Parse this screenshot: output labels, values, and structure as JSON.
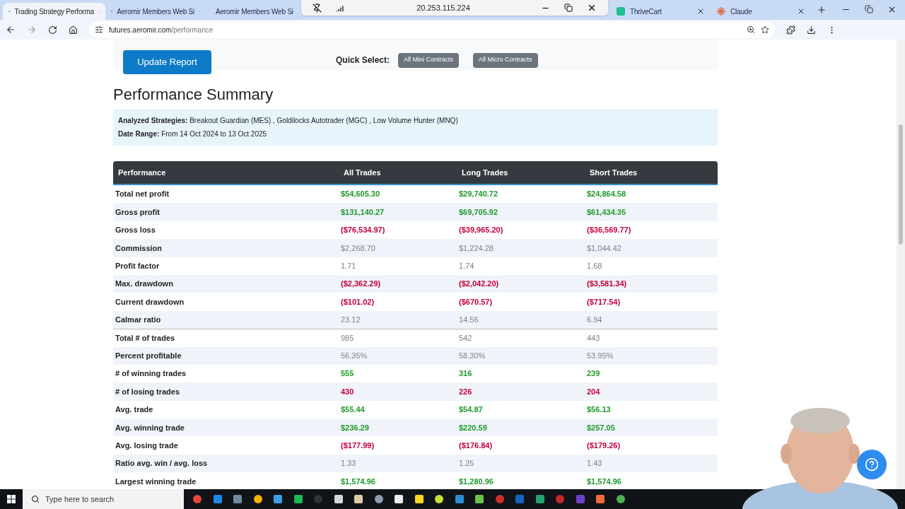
{
  "tabs": [
    {
      "title": "Trading Strategy Performa",
      "selected": true,
      "kind": "site"
    },
    {
      "title": "Aeromir Members Web Si",
      "selected": false,
      "kind": "site"
    },
    {
      "title": "Aeromir Members Web Si",
      "selected": false,
      "kind": "site"
    },
    {
      "title": "ThriveCart",
      "selected": false,
      "kind": "cart"
    },
    {
      "title": "Claude",
      "selected": false,
      "kind": "spark"
    }
  ],
  "remote_toolbar": {
    "address": "20.253.115.224"
  },
  "address_bar": {
    "host": "futures.aeromir.com",
    "path": "/performance"
  },
  "form": {
    "update_button": "Update Report",
    "quick_select_label": "Quick Select:",
    "quick_buttons": [
      "All Mini Contracts",
      "All Micro Contracts"
    ]
  },
  "title": "Performance Summary",
  "info": [
    {
      "label": "Analyzed Strategies:",
      "value": "Breakout Guardian (MES) , Goldilocks Autotrader (MGC) , Low Volume Hunter (MNQ)"
    },
    {
      "label": "Date Range:",
      "value": "From 14 Oct 2024 to 13 Oct 2025"
    }
  ],
  "table": {
    "columns": [
      "Performance",
      "All Trades",
      "Long Trades",
      "Short Trades"
    ],
    "rows": [
      {
        "kind": "positive",
        "cells": [
          "Total net profit",
          "$54,605.30",
          "$29,740.72",
          "$24,864.58"
        ]
      },
      {
        "kind": "positive",
        "cells": [
          "Gross profit",
          "$131,140.27",
          "$69,705.92",
          "$61,434.35"
        ]
      },
      {
        "kind": "negative",
        "cells": [
          "Gross loss",
          "($76,534.97)",
          "($39,965.20)",
          "($36,569.77)"
        ]
      },
      {
        "kind": "neutral",
        "cells": [
          "Commission",
          "$2,268.70",
          "$1,224.28",
          "$1,044.42"
        ]
      },
      {
        "kind": "neutral",
        "cells": [
          "Profit factor",
          "1.71",
          "1.74",
          "1.68"
        ]
      },
      {
        "kind": "negative",
        "cells": [
          "Max. drawdown",
          "($2,362.29)",
          "($2,042.20)",
          "($3,581.34)"
        ]
      },
      {
        "kind": "negative",
        "cells": [
          "Current drawdown",
          "($101.02)",
          "($670.57)",
          "($717.54)"
        ]
      },
      {
        "kind": "neutral",
        "cells": [
          "Calmar ratio",
          "23.12",
          "14.56",
          "6.94"
        ]
      },
      {
        "kind": "neutral",
        "cells": [
          "Total # of trades",
          "985",
          "542",
          "443"
        ]
      },
      {
        "kind": "neutral",
        "cells": [
          "Percent profitable",
          "56.35%",
          "58.30%",
          "53.95%"
        ]
      },
      {
        "kind": "positive",
        "cells": [
          "# of winning trades",
          "555",
          "316",
          "239"
        ]
      },
      {
        "kind": "negative",
        "cells": [
          "# of losing trades",
          "430",
          "226",
          "204"
        ]
      },
      {
        "kind": "positive",
        "cells": [
          "Avg. trade",
          "$55.44",
          "$54.87",
          "$56.13"
        ]
      },
      {
        "kind": "positive",
        "cells": [
          "Avg. winning trade",
          "$236.29",
          "$220.59",
          "$257.05"
        ]
      },
      {
        "kind": "negative",
        "cells": [
          "Avg. losing trade",
          "($177.99)",
          "($176.84)",
          "($179.26)"
        ]
      },
      {
        "kind": "neutral",
        "cells": [
          "Ratio avg. win / avg. loss",
          "1.33",
          "1.25",
          "1.43"
        ]
      },
      {
        "kind": "positive",
        "cells": [
          "Largest winning trade",
          "$1,574.96",
          "$1,280.96",
          "$1,574.96"
        ]
      }
    ]
  },
  "taskbar": {
    "search_placeholder": "Type here to search"
  }
}
